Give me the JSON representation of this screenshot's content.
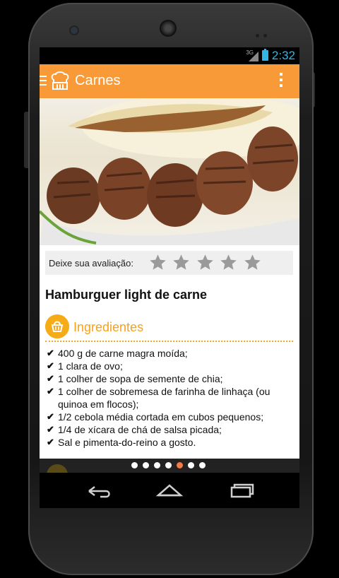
{
  "status_bar": {
    "network": "3G",
    "time": "2:32"
  },
  "action_bar": {
    "title": "Carnes"
  },
  "rating": {
    "label": "Deixe sua avaliação:",
    "stars_total": 5,
    "stars_filled": 0
  },
  "recipe": {
    "title": "Hamburguer light de carne",
    "ingredients_heading": "Ingredientes",
    "ingredients": [
      "400 g de carne magra moída;",
      "1 clara de ovo;",
      "1 colher de sopa de semente de chia;",
      "1 colher de sobremesa de farinha de linhaça (ou quinoa em flocos);",
      "1/2 cebola média cortada em cubos pequenos;",
      "1/4 de xícara de chá de salsa picada;",
      "Sal e pimenta-do-reino a gosto."
    ]
  },
  "pager": {
    "pages": 7,
    "current": 5
  },
  "colors": {
    "accent": "#f99a39",
    "ingredients": "#f6ab19",
    "status_text": "#33b5e5",
    "pager_active": "#f47a46"
  },
  "icons": {
    "menu": "drawer-icon",
    "app": "chef-hat-icon",
    "overflow": "more-vert-icon",
    "ingredients": "basket-icon",
    "nav": [
      "back-icon",
      "home-icon",
      "recent-apps-icon"
    ]
  }
}
